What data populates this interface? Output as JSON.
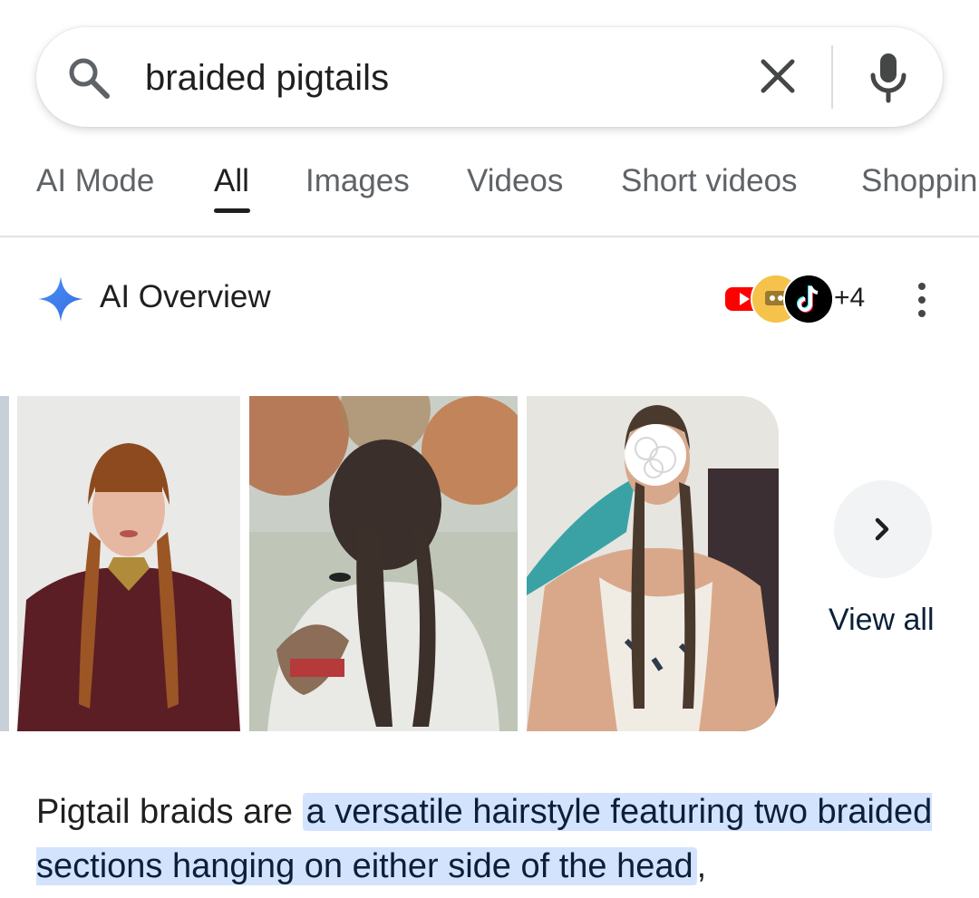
{
  "search": {
    "query": "braided pigtails"
  },
  "tabs": [
    {
      "label": "AI Mode",
      "active": false
    },
    {
      "label": "All",
      "active": true
    },
    {
      "label": "Images",
      "active": false
    },
    {
      "label": "Videos",
      "active": false
    },
    {
      "label": "Short videos",
      "active": false
    },
    {
      "label": "Shoppin",
      "active": false
    }
  ],
  "ai_overview": {
    "title": "AI Overview",
    "sources_more": "+4",
    "source_icons": [
      "youtube-icon",
      "avatar-icon",
      "tiktok-icon"
    ]
  },
  "gallery": {
    "view_all": "View all"
  },
  "summary": {
    "prefix": "Pigtail braids are ",
    "highlight": "a versatile hairstyle featuring two braided sections hanging on either side of the head",
    "suffix": ","
  },
  "colors": {
    "highlight_bg": "#d3e3fd",
    "ai_sparkle": "#4285f4",
    "youtube": "#ff0000"
  }
}
